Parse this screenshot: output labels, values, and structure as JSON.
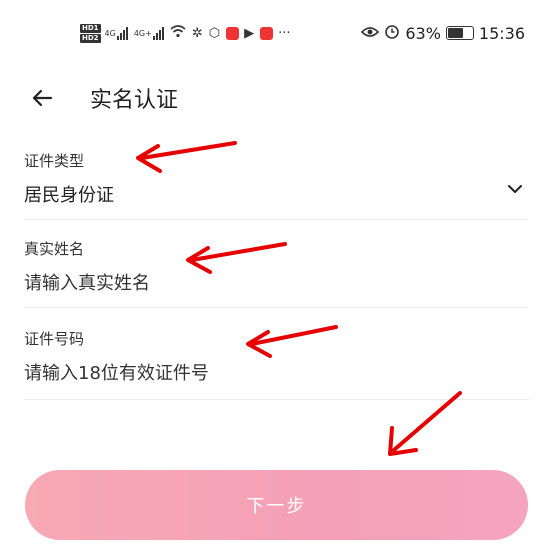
{
  "status_bar": {
    "network1": "4G",
    "network2": "4G+",
    "more": "···",
    "battery": "63%",
    "time": "15:36"
  },
  "header": {
    "title": "实名认证"
  },
  "form": {
    "id_type": {
      "label": "证件类型",
      "value": "居民身份证"
    },
    "real_name": {
      "label": "真实姓名",
      "placeholder": "请输入真实姓名"
    },
    "id_number": {
      "label": "证件号码",
      "placeholder": "请输入18位有效证件号"
    }
  },
  "next_button": {
    "label": "下一步"
  },
  "colors": {
    "annotation_arrow": "#e60000",
    "button_gradient_start": "#f7a9b4",
    "button_gradient_end": "#f5a4c0"
  }
}
